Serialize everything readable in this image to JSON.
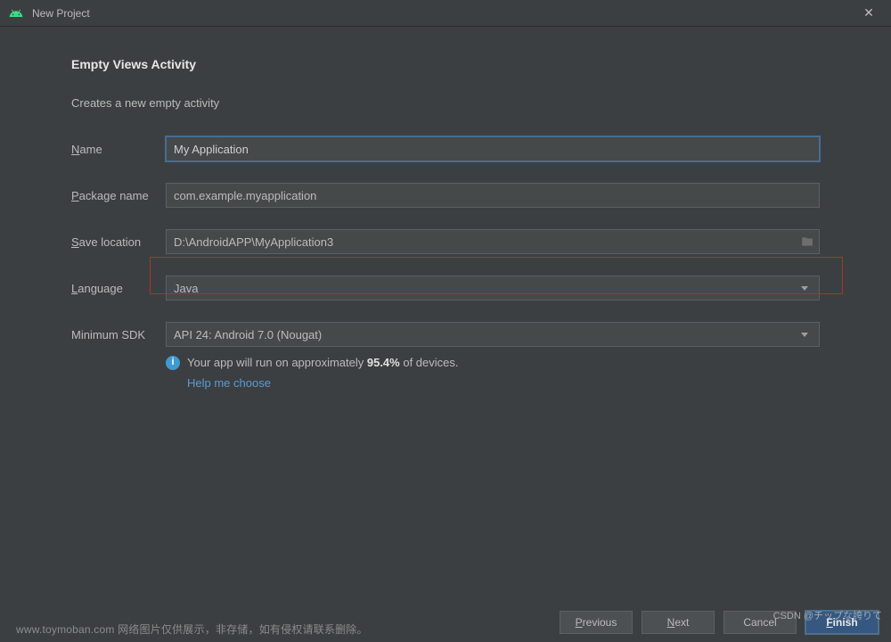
{
  "window": {
    "title": "New Project"
  },
  "page": {
    "heading": "Empty Views Activity",
    "subtitle": "Creates a new empty activity"
  },
  "form": {
    "name": {
      "label_pre": "N",
      "label_rest": "ame",
      "value": "My Application"
    },
    "package": {
      "label_pre": "P",
      "label_rest": "ackage name",
      "value": "com.example.myapplication"
    },
    "save": {
      "label_pre": "S",
      "label_rest": "ave location",
      "value": "D:\\AndroidAPP\\MyApplication3"
    },
    "language": {
      "label_pre": "L",
      "label_rest": "anguage",
      "value": "Java"
    },
    "sdk": {
      "label": "Minimum SDK",
      "value": "API 24: Android 7.0 (Nougat)"
    }
  },
  "info": {
    "text_before": "Your app will run on approximately ",
    "percent": "95.4%",
    "text_after": " of devices.",
    "help_link": "Help me choose"
  },
  "buttons": {
    "previous_pre": "P",
    "previous_rest": "revious",
    "next_pre": "N",
    "next_rest": "ext",
    "cancel": "Cancel",
    "finish_pre": "F",
    "finish_rest": "inish"
  },
  "watermarks": {
    "left": "www.toymoban.com 网络图片仅供展示，非存储，如有侵权请联系删除。",
    "right": "CSDN @チップな誇りて"
  }
}
